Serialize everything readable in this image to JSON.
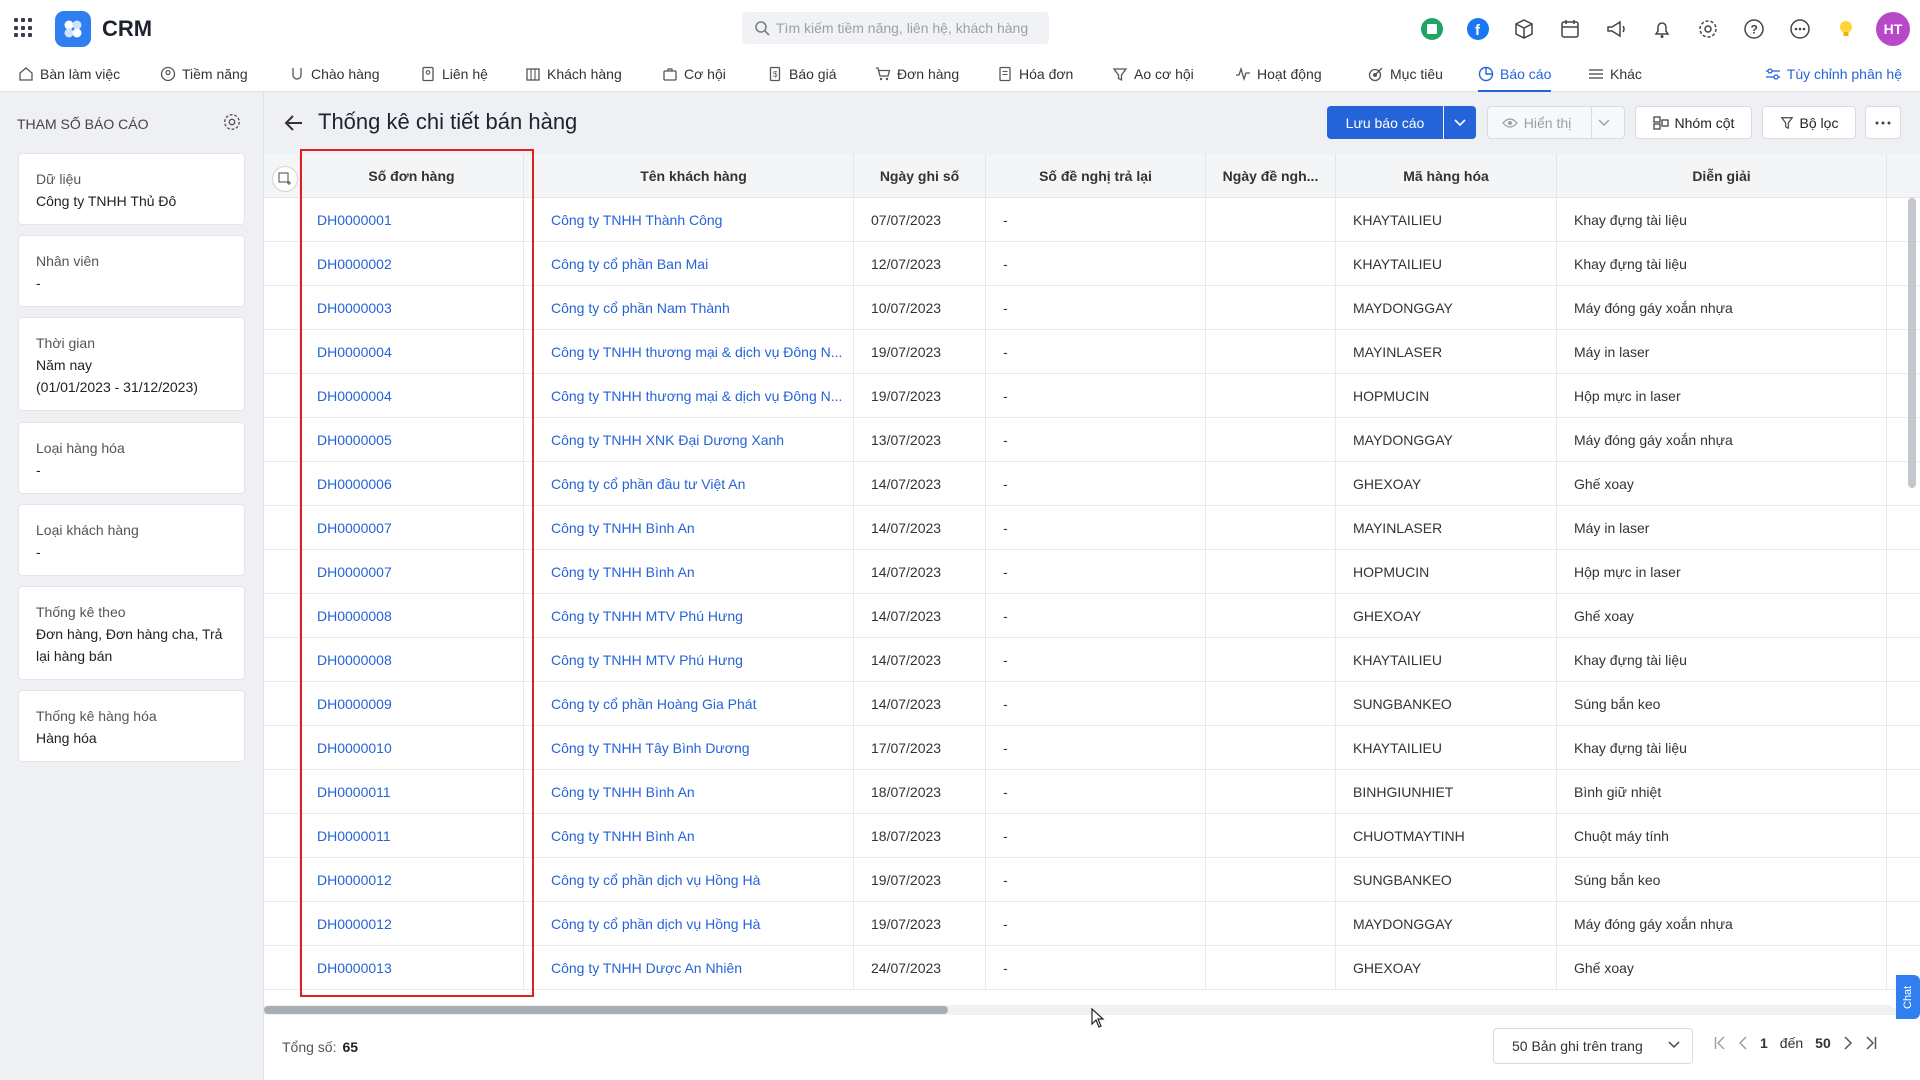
{
  "app": {
    "name": "CRM"
  },
  "search": {
    "placeholder": "Tìm kiếm tiềm năng, liên hệ, khách hàng"
  },
  "user": {
    "initials": "HT"
  },
  "nav": {
    "items": [
      {
        "label": "Bàn làm việc",
        "icon": "home-icon"
      },
      {
        "label": "Tiềm năng",
        "icon": "lead-icon"
      },
      {
        "label": "Chào hàng",
        "icon": "offer-icon"
      },
      {
        "label": "Liên hệ",
        "icon": "contact-icon"
      },
      {
        "label": "Khách hàng",
        "icon": "customer-icon"
      },
      {
        "label": "Cơ hội",
        "icon": "opportunity-icon"
      },
      {
        "label": "Báo giá",
        "icon": "quote-icon"
      },
      {
        "label": "Đơn hàng",
        "icon": "cart-icon"
      },
      {
        "label": "Hóa đơn",
        "icon": "invoice-icon"
      },
      {
        "label": "Ao cơ hội",
        "icon": "funnel-icon"
      },
      {
        "label": "Hoạt động",
        "icon": "activity-icon"
      },
      {
        "label": "Mục tiêu",
        "icon": "target-icon"
      },
      {
        "label": "Báo cáo",
        "icon": "report-icon"
      },
      {
        "label": "Khác",
        "icon": "menu-icon"
      }
    ],
    "active_index": 12,
    "customize_label": "Tùy chỉnh phân hệ"
  },
  "sidebar": {
    "title": "THAM SỐ BÁO CÁO",
    "params": [
      {
        "label": "Dữ liệu",
        "value": "Công ty TNHH Thủ Đô"
      },
      {
        "label": "Nhân viên",
        "value": "-"
      },
      {
        "label": "Thời gian",
        "value": "Năm nay",
        "value2": "(01/01/2023 - 31/12/2023)"
      },
      {
        "label": "Loại hàng hóa",
        "value": "-"
      },
      {
        "label": "Loại khách hàng",
        "value": "-"
      },
      {
        "label": "Thống kê theo",
        "value": "Đơn hàng, Đơn hàng cha, Trả",
        "value2": "lại hàng bán"
      },
      {
        "label": "Thống kê hàng hóa",
        "value": "Hàng hóa"
      }
    ]
  },
  "report": {
    "title": "Thống kê chi tiết bán hàng",
    "save_label": "Lưu báo cáo",
    "display_label": "Hiển thị",
    "group_label": "Nhóm cột",
    "filter_label": "Bộ lọc"
  },
  "table": {
    "columns": [
      "Số đơn hàng",
      "Tên khách hàng",
      "Ngày ghi số",
      "Số đề nghị trả lại",
      "Ngày đề ngh...",
      "Mã hàng hóa",
      "Diễn giải"
    ],
    "rows": [
      [
        "DH0000001",
        "Công ty TNHH Thành Công",
        "07/07/2023",
        "-",
        "",
        "KHAYTAILIEU",
        "Khay đựng tài liệu"
      ],
      [
        "DH0000002",
        "Công ty cổ phần Ban Mai",
        "12/07/2023",
        "-",
        "",
        "KHAYTAILIEU",
        "Khay đựng tài liệu"
      ],
      [
        "DH0000003",
        "Công ty cổ phần Nam Thành",
        "10/07/2023",
        "-",
        "",
        "MAYDONGGAY",
        "Máy đóng gáy xoắn nhựa"
      ],
      [
        "DH0000004",
        "Công ty TNHH thương mại & dịch vụ Đông N...",
        "19/07/2023",
        "-",
        "",
        "MAYINLASER",
        "Máy in laser"
      ],
      [
        "DH0000004",
        "Công ty TNHH thương mại & dịch vụ Đông N...",
        "19/07/2023",
        "-",
        "",
        "HOPMUCIN",
        "Hộp mực in laser"
      ],
      [
        "DH0000005",
        "Công ty TNHH XNK Đại Dương Xanh",
        "13/07/2023",
        "-",
        "",
        "MAYDONGGAY",
        "Máy đóng gáy xoắn nhựa"
      ],
      [
        "DH0000006",
        "Công ty cổ phần đầu tư Việt An",
        "14/07/2023",
        "-",
        "",
        "GHEXOAY",
        "Ghế xoay"
      ],
      [
        "DH0000007",
        "Công ty TNHH Bình An",
        "14/07/2023",
        "-",
        "",
        "MAYINLASER",
        "Máy in laser"
      ],
      [
        "DH0000007",
        "Công ty TNHH Bình An",
        "14/07/2023",
        "-",
        "",
        "HOPMUCIN",
        "Hộp mực in laser"
      ],
      [
        "DH0000008",
        "Công ty TNHH MTV Phú Hưng",
        "14/07/2023",
        "-",
        "",
        "GHEXOAY",
        "Ghế xoay"
      ],
      [
        "DH0000008",
        "Công ty TNHH MTV Phú Hưng",
        "14/07/2023",
        "-",
        "",
        "KHAYTAILIEU",
        "Khay đựng tài liệu"
      ],
      [
        "DH0000009",
        "Công ty cổ phần Hoàng Gia Phát",
        "14/07/2023",
        "-",
        "",
        "SUNGBANKEO",
        "Súng bắn keo"
      ],
      [
        "DH0000010",
        "Công ty TNHH Tây Bình Dương",
        "17/07/2023",
        "-",
        "",
        "KHAYTAILIEU",
        "Khay đựng tài liệu"
      ],
      [
        "DH0000011",
        "Công ty TNHH Bình An",
        "18/07/2023",
        "-",
        "",
        "BINHGIUNHIET",
        "Bình giữ nhiệt"
      ],
      [
        "DH0000011",
        "Công ty TNHH Bình An",
        "18/07/2023",
        "-",
        "",
        "CHUOTMAYTINH",
        "Chuột máy tính"
      ],
      [
        "DH0000012",
        "Công ty cổ phần dịch vụ Hồng Hà",
        "19/07/2023",
        "-",
        "",
        "SUNGBANKEO",
        "Súng bắn keo"
      ],
      [
        "DH0000012",
        "Công ty cổ phần dịch vụ Hồng Hà",
        "19/07/2023",
        "-",
        "",
        "MAYDONGGAY",
        "Máy đóng gáy xoắn nhựa"
      ],
      [
        "DH0000013",
        "Công ty TNHH Dược An Nhiên",
        "24/07/2023",
        "-",
        "",
        "GHEXOAY",
        "Ghế xoay"
      ]
    ]
  },
  "footer": {
    "total_label": "Tổng số:",
    "total": "65",
    "page_size_label": "50 Bản ghi trên trang",
    "from": "1",
    "to_label": "đến",
    "to": "50"
  },
  "chat": {
    "label": "Chat"
  },
  "scroll": {
    "horizontal_visible_fraction": 0.42
  },
  "colors": {
    "accent": "#2563d9",
    "highlight_box": "#e02020",
    "avatar": "#b848c8"
  }
}
